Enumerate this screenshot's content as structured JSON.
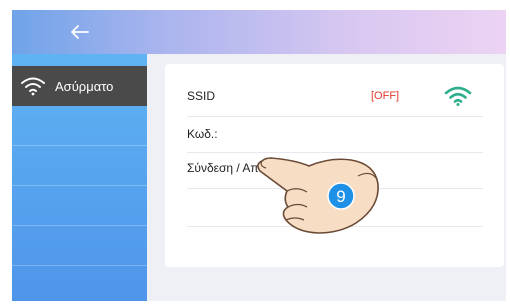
{
  "header": {
    "back_icon": "arrow-left-icon"
  },
  "sidebar": {
    "items": [
      {
        "label": "Ασύρματο",
        "icon": "wifi-icon",
        "active": true
      }
    ]
  },
  "wifi": {
    "ssid_label": "SSID",
    "status": "[OFF]",
    "password_label": "Κωδ.:",
    "connect_label": "Σύνδεση / Αποσύνδ:"
  },
  "overlay": {
    "step_number": "9",
    "icon": "pointing-hand-icon"
  },
  "colors": {
    "status_off": "#e03a2c",
    "wifi_icon": "#2fae8e",
    "sidebar": "#4f95ea",
    "active_item": "#4a4a4a",
    "badge": "#1e90e6"
  }
}
